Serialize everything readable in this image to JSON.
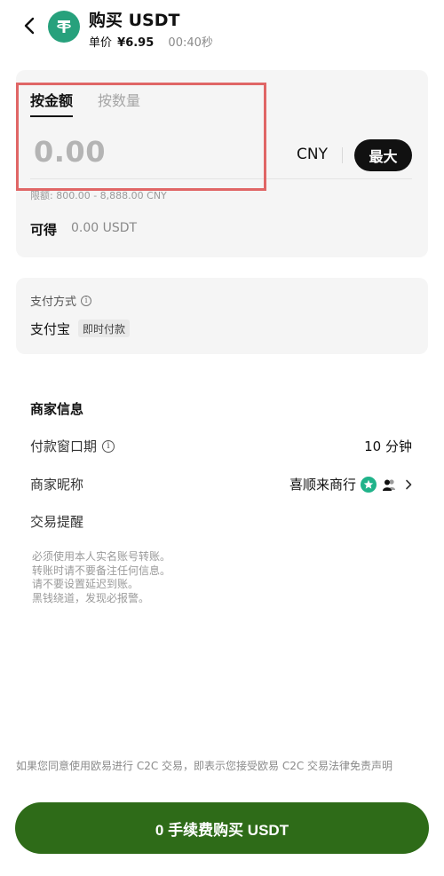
{
  "header": {
    "title": "购买 USDT",
    "unit_price_label": "单价",
    "unit_price_value": "¥6.95",
    "countdown": "00:40秒",
    "back_icon": "chevron-left-icon",
    "coin_icon": "usdt-coin-icon"
  },
  "order": {
    "tabs": [
      {
        "label": "按金额",
        "active": true
      },
      {
        "label": "按数量",
        "active": false
      }
    ],
    "amount_placeholder": "0.00",
    "currency": "CNY",
    "max_label": "最大",
    "limit_text": "限额: 800.00 - 8,888.00 CNY",
    "receive_label": "可得",
    "receive_value": "0.00 USDT"
  },
  "payment": {
    "title": "支付方式",
    "method": "支付宝",
    "badge": "即时付款"
  },
  "merchant": {
    "section_title": "商家信息",
    "payment_window_label": "付款窗口期",
    "payment_window_value": "10 分钟",
    "nickname_label": "商家昵称",
    "nickname_value": "喜顺来商行",
    "reminder_label": "交易提醒",
    "reminder_lines": [
      "必须使用本人实名账号转账。",
      "转账时请不要备注任何信息。",
      "请不要设置延迟到账。",
      "黑钱绕道，发现必报警。"
    ]
  },
  "footer": {
    "disclaimer": "如果您同意使用欧易进行 C2C 交易，即表示您接受欧易 C2C 交易法律免责声明",
    "buy_button": "0 手续费购买 USDT"
  },
  "colors": {
    "primary_button": "#2e6b18",
    "tether_green": "#27a17c",
    "highlight_border": "#e06666"
  }
}
